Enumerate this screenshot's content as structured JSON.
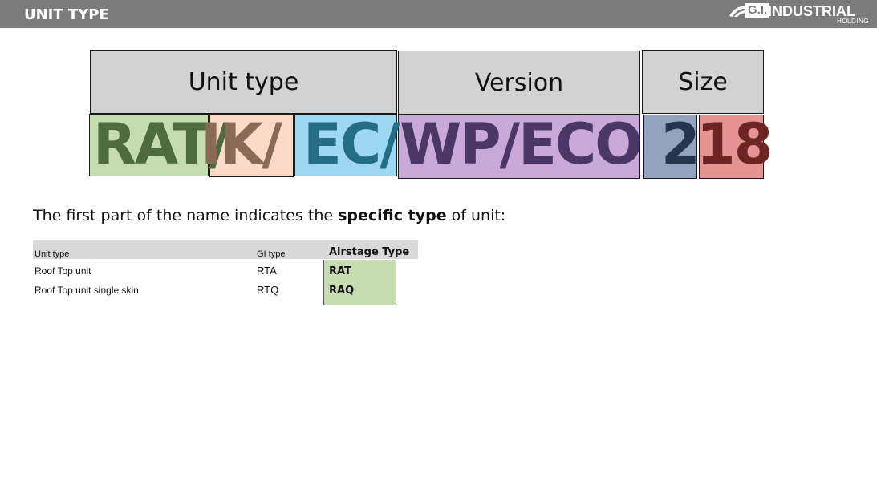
{
  "slide": {
    "title": "UNIT TYPE",
    "logo": {
      "badge": "G.I.",
      "name": "INDUSTRIAL",
      "sub": "HOLDING"
    }
  },
  "diagram": {
    "headers": {
      "unit_type": "Unit type",
      "version": "Version",
      "size": "Size"
    },
    "segments": [
      {
        "text": "RAT/",
        "color": "#4e6b3f",
        "bg": "#c5dcb0"
      },
      {
        "text": "IK/",
        "color": "#8a6a55",
        "bg": "#fbdbc8"
      },
      {
        "text": "EC/",
        "color": "#256d86",
        "bg": "#9ed7f2"
      },
      {
        "text": "WP/ECO",
        "color": "#4b3766",
        "bg": "#c8a9d8"
      },
      {
        "text": "2",
        "color": "#27344d",
        "bg": "#93a2be"
      },
      {
        "text": "18",
        "color": "#6d2424",
        "bg": "#e59494"
      }
    ]
  },
  "intro": {
    "prefix": "The first part of the name indicates the ",
    "bold": "specific type",
    "suffix": " of unit:"
  },
  "table": {
    "headers": {
      "unit_type": "Unit type",
      "gi_type": "GI type",
      "airstage_type": "Airstage Type"
    },
    "rows": [
      {
        "unit_type": "Roof Top unit",
        "gi_type": "RTA",
        "airstage_type": "RAT"
      },
      {
        "unit_type": "Roof Top unit single skin",
        "gi_type": "RTQ",
        "airstage_type": "RAQ"
      }
    ]
  }
}
